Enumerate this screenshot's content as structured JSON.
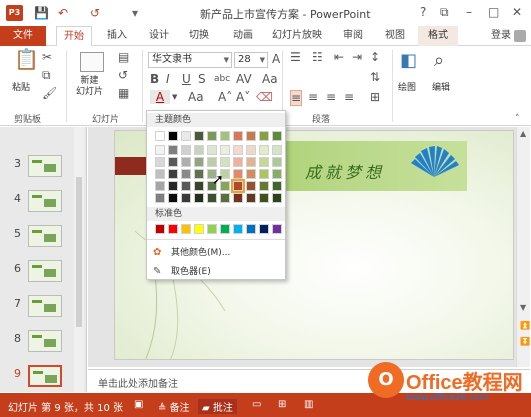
{
  "app": {
    "icon_label": "P3",
    "title": "新产品上市宣传方案 - PowerPoint",
    "help": "?",
    "ribbon_display": "⧉",
    "minimize": "–",
    "restore": "□",
    "close": "✕"
  },
  "quick_access": {
    "save": "💾",
    "undo": "↶",
    "redo": "↺",
    "customize": "▾"
  },
  "tabs": [
    {
      "label": "文件"
    },
    {
      "label": "开始"
    },
    {
      "label": "插入"
    },
    {
      "label": "设计"
    },
    {
      "label": "切换"
    },
    {
      "label": "动画"
    },
    {
      "label": "幻灯片放映"
    },
    {
      "label": "审阅"
    },
    {
      "label": "视图"
    },
    {
      "label": "格式"
    }
  ],
  "login": "登录",
  "ribbon": {
    "clipboard": {
      "label": "剪贴板",
      "paste": "粘贴"
    },
    "slides": {
      "label": "幻灯片",
      "new_slide": "新建\n幻灯片"
    },
    "font": {
      "name": "华文隶书",
      "size": "28"
    },
    "paragraph": {
      "label": "段落"
    },
    "drawing": {
      "label": "绘图"
    },
    "editing": {
      "label": "编辑"
    }
  },
  "color_menu": {
    "theme_header": "主题颜色",
    "standard_header": "标准色",
    "more_colors": "其他颜色(M)...",
    "eyedropper": "取色器(E)",
    "theme_top": [
      "#ffffff",
      "#000000",
      "#e8e8e8",
      "#4a5a3a",
      "#7a9a5a",
      "#a4c27c",
      "#d8785a",
      "#c47a4a",
      "#8aa040",
      "#5c8a3a"
    ],
    "theme_shades": [
      [
        "#f2f2f2",
        "#7f7f7f",
        "#d0d0d0",
        "#c8d2bc",
        "#dde6d2",
        "#e9f0de",
        "#f5d8cd",
        "#efd8c8",
        "#e3ebc8",
        "#d5e4c8"
      ],
      [
        "#d8d8d8",
        "#595959",
        "#aeaeae",
        "#93a684",
        "#bccdab",
        "#d3e1c0",
        "#ecb29c",
        "#e0b393",
        "#c9d794",
        "#acc998"
      ],
      [
        "#bfbfbf",
        "#3f3f3f",
        "#8a8a8a",
        "#5f7250",
        "#9ab286",
        "#bfd3a2",
        "#e28b6c",
        "#d18d5f",
        "#aec360",
        "#84ae66"
      ],
      [
        "#a5a5a5",
        "#262626",
        "#5a5a5a",
        "#38442c",
        "#5c7844",
        "#86a65a",
        "#b24a2a",
        "#955230",
        "#687a2c",
        "#42652a"
      ],
      [
        "#7f7f7f",
        "#0c0c0c",
        "#3a3a3a",
        "#252d1d",
        "#3d502d",
        "#59703c",
        "#77311c",
        "#633720",
        "#45511d",
        "#2c431c"
      ]
    ],
    "standard": [
      "#c00000",
      "#ff0000",
      "#ffc000",
      "#ffff00",
      "#92d050",
      "#00b050",
      "#00b0f0",
      "#0070c0",
      "#002060",
      "#7030a0"
    ],
    "selected": {
      "row": 3,
      "col": 6
    }
  },
  "thumbnails": [
    {
      "num": "3"
    },
    {
      "num": "4"
    },
    {
      "num": "5"
    },
    {
      "num": "6"
    },
    {
      "num": "7"
    },
    {
      "num": "8"
    },
    {
      "num": "9",
      "selected": true
    }
  ],
  "slide": {
    "title": "成就梦想"
  },
  "notes_placeholder": "单击此处添加备注",
  "status": {
    "slide_info": "幻灯片 第 9 张，共 10 张",
    "notes": "备注",
    "comments": "批注"
  },
  "watermark": {
    "logo": "O",
    "text": "Office教程网",
    "url": "www.office26.com"
  }
}
